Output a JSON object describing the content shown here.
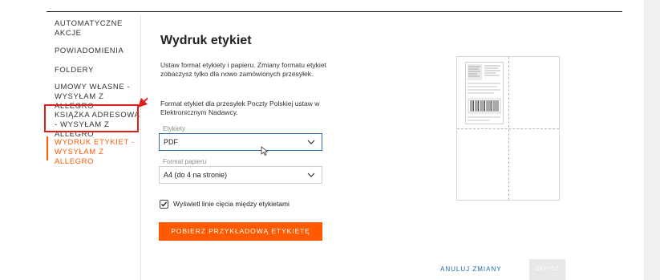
{
  "sidebar": {
    "items": [
      {
        "label": "AUTOMATYCZNE AKCJE"
      },
      {
        "label": "POWIADOMIENIA"
      },
      {
        "label": "FOLDERY"
      },
      {
        "label": "UMOWY WŁASNE - WYSYŁAM Z ALLEGRO"
      },
      {
        "label": "KSIĄŻKA ADRESOWA - WYSYŁAM Z ALLEGRO"
      },
      {
        "label": "WYDRUK ETYKIET - WYSYŁAM Z ALLEGRO"
      }
    ],
    "active_index": 5
  },
  "main": {
    "title": "Wydruk etykiet",
    "desc1": "Ustaw format etykiety i papieru. Zmiany formatu etykiet zobaczysz tylko dla nowo zamówionych przesyłek.",
    "desc2": "Format etykiet dla przesyłek Poczty Polskiej ustaw w Elektronicznym Nadawcy.",
    "labels_field": {
      "label": "Etykiety",
      "value": "PDF"
    },
    "paper_field": {
      "label": "Format papieru",
      "value": "A4 (do 4 na stronie)"
    },
    "cut_lines": {
      "label": "Wyświetl linie cięcia między etykietami",
      "checked": true
    },
    "download_button": "POBIERZ PRZYKŁADOWĄ ETYKIETĘ",
    "cancel_button": "ANULUJ ZMIANY",
    "save_button": "ZAPISZ"
  },
  "colors": {
    "accent": "#ff5a00",
    "link": "#1a6ca6",
    "highlight": "#e21d1d",
    "focus": "#2a6fb0"
  }
}
